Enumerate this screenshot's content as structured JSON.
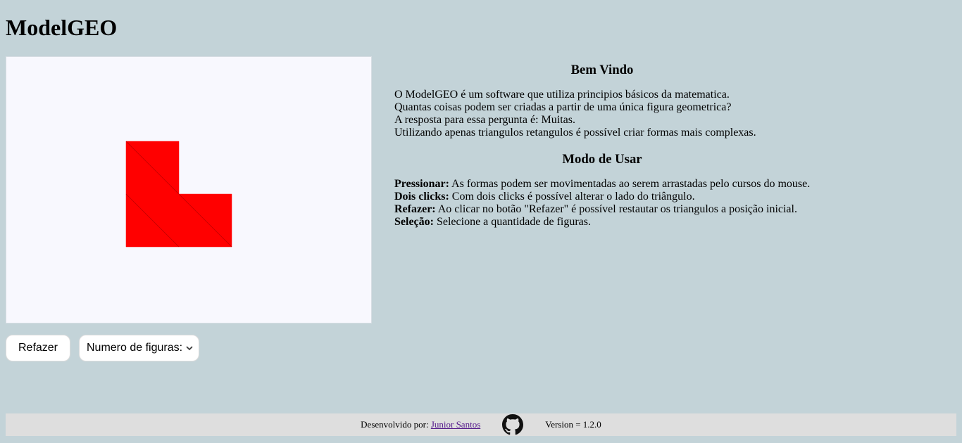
{
  "header": {
    "title": "ModelGEO"
  },
  "canvas": {
    "shape_color": "#ff0000",
    "background": "#f8f8fe"
  },
  "controls": {
    "redo_label": "Refazer",
    "figures_select": {
      "selected": "Numero de figuras:"
    }
  },
  "info": {
    "welcome": {
      "heading": "Bem Vindo",
      "lines": [
        "O ModelGEO é um software que utiliza principios básicos da matematica.",
        "Quantas coisas podem ser criadas a partir de uma única figura geometrica?",
        "A resposta para essa pergunta é: Muitas.",
        "Utilizando apenas triangulos retangulos é possível criar formas mais complexas."
      ]
    },
    "usage": {
      "heading": "Modo de Usar",
      "items": [
        {
          "term": "Pressionar:",
          "text": "As formas podem ser movimentadas ao serem arrastadas pelo cursos do mouse."
        },
        {
          "term": "Dois clicks:",
          "text": "Com dois clicks é possível alterar o lado do triângulo."
        },
        {
          "term": "Refazer:",
          "text": "Ao clicar no botão \"Refazer\" é possível restautar os triangulos a posição inicial."
        },
        {
          "term": "Seleção:",
          "text": "Selecione a quantidade de figuras."
        }
      ]
    }
  },
  "footer": {
    "credit_prefix": "Desenvolvido por:",
    "author": "Junior Santos",
    "github_icon": "github-icon",
    "version": "Version = 1.2.0"
  },
  "colors": {
    "page_background": "#c3d3d8",
    "footer_background": "#dedede",
    "link": "#551a8b"
  }
}
